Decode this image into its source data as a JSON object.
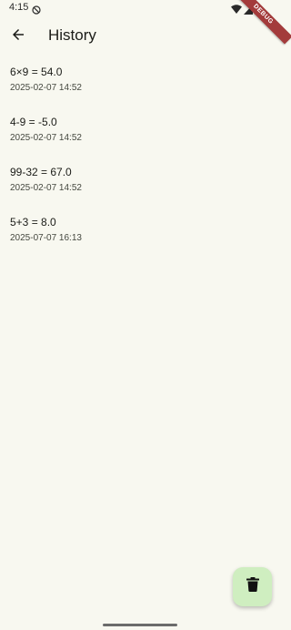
{
  "status_bar": {
    "time": "4:15",
    "icons": [
      "dnd-icon",
      "wifi-icon",
      "signal-icon",
      "battery-icon"
    ]
  },
  "debug_banner": {
    "label": "DEBUG"
  },
  "app_bar": {
    "title": "History",
    "back_icon": "arrow-back-icon"
  },
  "history": {
    "items": [
      {
        "expression": "6×9 = 54.0",
        "timestamp": "2025-02-07 14:52"
      },
      {
        "expression": "4-9 = -5.0",
        "timestamp": "2025-02-07 14:52"
      },
      {
        "expression": "99-32 = 67.0",
        "timestamp": "2025-02-07 14:52"
      },
      {
        "expression": "5+3 = 8.0",
        "timestamp": "2025-07-07 16:13"
      }
    ]
  },
  "fab": {
    "icon": "delete-icon"
  },
  "colors": {
    "background": "#f8f8f0",
    "fab_background": "#cfeec0",
    "debug_ribbon": "#a33b3b",
    "text_primary": "#1b1c18",
    "text_secondary": "#45483f"
  }
}
